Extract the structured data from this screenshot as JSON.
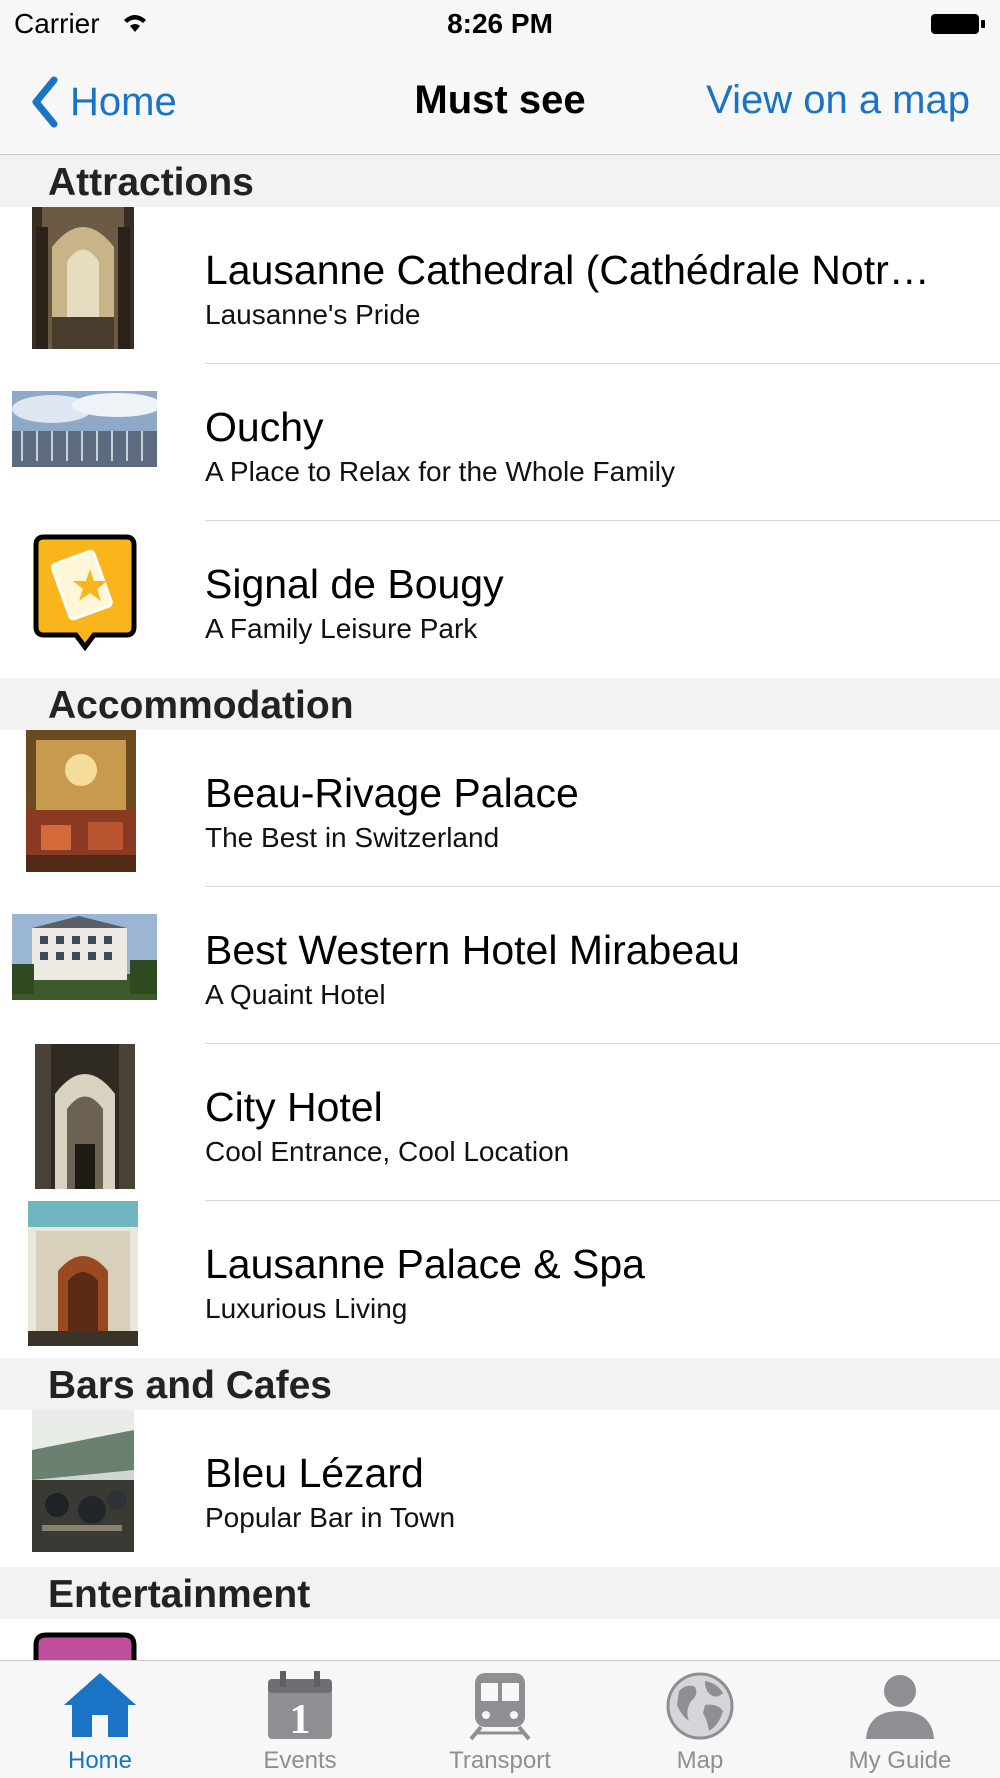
{
  "status_bar": {
    "carrier": "Carrier",
    "time": "8:26 PM"
  },
  "nav": {
    "back_label": "Home",
    "title": "Must see",
    "right_button": "View on a map"
  },
  "sections": [
    {
      "header": "Attractions",
      "items": [
        {
          "title": "Lausanne Cathedral (Cathédrale Notr…",
          "subtitle": "Lausanne's Pride",
          "thumb": "cathedral-photo"
        },
        {
          "title": "Ouchy",
          "subtitle": "A Place to Relax for the Whole Family",
          "thumb": "ouchy-photo"
        },
        {
          "title": "Signal de Bougy",
          "subtitle": "A Family Leisure Park",
          "thumb": "ticket-icon"
        }
      ]
    },
    {
      "header": "Accommodation",
      "items": [
        {
          "title": "Beau-Rivage Palace",
          "subtitle": "The Best in Switzerland",
          "thumb": "hotel-interior-photo"
        },
        {
          "title": "Best Western Hotel Mirabeau",
          "subtitle": "A Quaint Hotel",
          "thumb": "hotel-building-photo"
        },
        {
          "title": "City Hotel",
          "subtitle": "Cool Entrance, Cool Location",
          "thumb": "hotel-entrance-photo"
        },
        {
          "title": "Lausanne Palace & Spa",
          "subtitle": "Luxurious Living",
          "thumb": "palace-photo"
        }
      ]
    },
    {
      "header": "Bars and Cafes",
      "items": [
        {
          "title": "Bleu Lézard",
          "subtitle": "Popular Bar in Town",
          "thumb": "bar-photo"
        }
      ]
    },
    {
      "header": "Entertainment",
      "items": []
    }
  ],
  "tabs": [
    {
      "label": "Home",
      "icon": "house-icon",
      "active": true
    },
    {
      "label": "Events",
      "icon": "calendar-icon",
      "active": false
    },
    {
      "label": "Transport",
      "icon": "train-icon",
      "active": false
    },
    {
      "label": "Map",
      "icon": "globe-icon",
      "active": false
    },
    {
      "label": "My Guide",
      "icon": "person-icon",
      "active": false
    }
  ],
  "colors": {
    "accent": "#1a73c5",
    "inactive_tab": "#8e8e93",
    "section_bg": "#f2f2f2",
    "ticket_yellow": "#f9b51b",
    "entertainment_magenta": "#c0509e"
  }
}
